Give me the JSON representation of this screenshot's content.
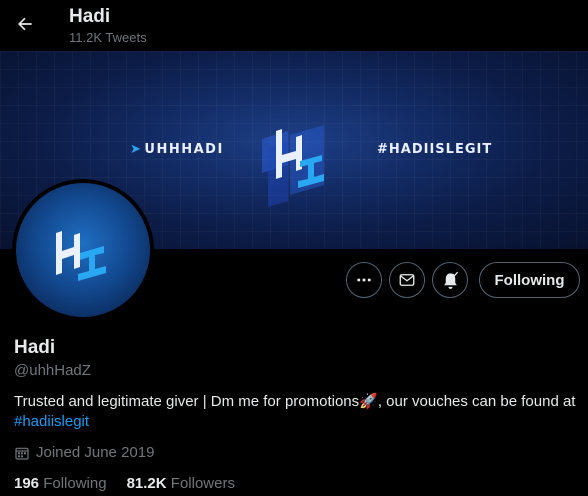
{
  "header": {
    "title": "Hadi",
    "tweet_count": "11.2K Tweets"
  },
  "banner": {
    "handle_text": "UHHHADI",
    "hashtag_text": "#HADIISLEGIT"
  },
  "profile": {
    "name": "Hadi",
    "handle": "@uhhHadZ",
    "bio_text": "Trusted and legitimate giver | Dm me for promotions",
    "bio_emoji": "🚀",
    "bio_text_2": ", our vouches can be found at",
    "bio_link": "#hadiislegit",
    "joined": "Joined June 2019",
    "following_count": "196",
    "following_label": "Following",
    "followers_count": "81.2K",
    "followers_label": "Followers"
  },
  "actions": {
    "follow_label": "Following"
  },
  "icons": {
    "back": "back-arrow-icon",
    "more": "more-icon",
    "message": "envelope-icon",
    "notify": "bell-icon",
    "calendar": "calendar-icon"
  },
  "colors": {
    "accent": "#1d9bf0",
    "muted": "#71767b",
    "border": "#536471"
  }
}
